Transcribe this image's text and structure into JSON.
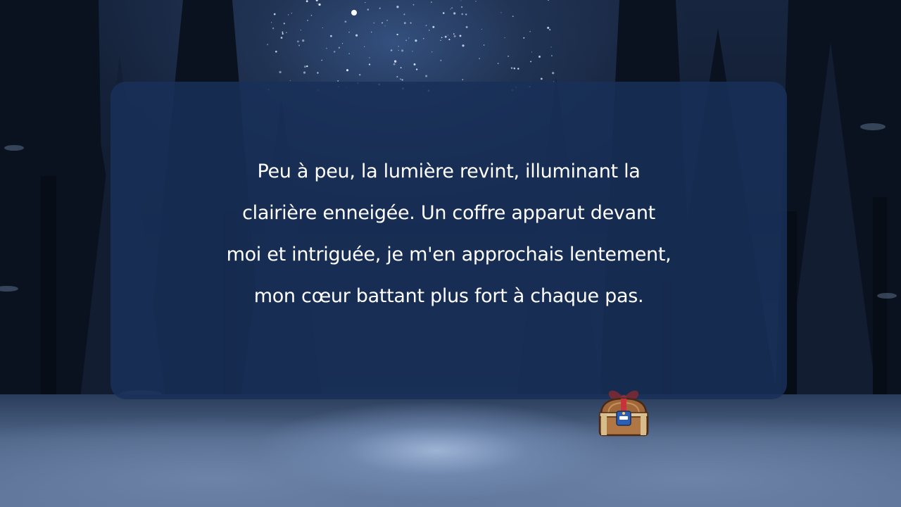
{
  "background": {
    "scene": "night-snowy-forest",
    "icon": "night-sky-forest-icon"
  },
  "story_card": {
    "text": "Peu à peu, la lumière revint, illuminant la\nclairière enneigée. Un coffre apparut devant\nmoi et intriguée, je m'en approchais lentement,\nmon cœur battant plus fort à chaque pas.",
    "bg_color": "#183058",
    "text_color": "#ffffff"
  },
  "chest": {
    "icon": "treasure-chest-icon",
    "ribbon_color": "#c8323c",
    "wood_color": "#a0683a",
    "lock_color": "#2b5fb4"
  }
}
